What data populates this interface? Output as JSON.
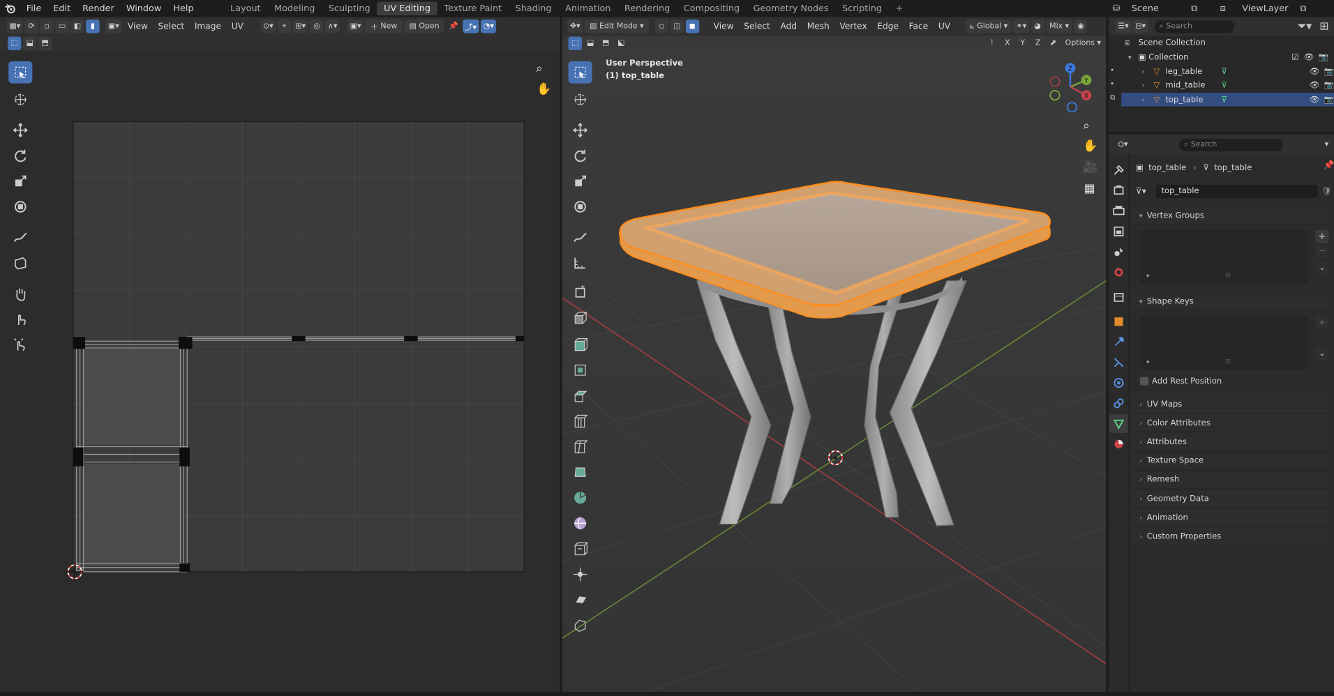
{
  "topbar": {
    "menus": [
      "File",
      "Edit",
      "Render",
      "Window",
      "Help"
    ],
    "workspaces": [
      {
        "label": "Layout",
        "active": false
      },
      {
        "label": "Modeling",
        "active": false
      },
      {
        "label": "Sculpting",
        "active": false
      },
      {
        "label": "UV Editing",
        "active": true
      },
      {
        "label": "Texture Paint",
        "active": false
      },
      {
        "label": "Shading",
        "active": false
      },
      {
        "label": "Animation",
        "active": false
      },
      {
        "label": "Rendering",
        "active": false
      },
      {
        "label": "Compositing",
        "active": false
      },
      {
        "label": "Geometry Nodes",
        "active": false
      },
      {
        "label": "Scripting",
        "active": false
      }
    ],
    "add_tab": "+",
    "scene": "Scene",
    "view_layer": "ViewLayer"
  },
  "uv_editor": {
    "menus": [
      "View",
      "Select",
      "Image",
      "UV"
    ],
    "new_label": "New",
    "open_label": "Open"
  },
  "viewport": {
    "mode": "Edit Mode",
    "menus": [
      "View",
      "Select",
      "Add",
      "Mesh",
      "Vertex",
      "Edge",
      "Face",
      "UV"
    ],
    "orientation": "Global",
    "shading_mix": "Mix",
    "options_label": "Options",
    "axis_x": "X",
    "axis_y": "Y",
    "axis_z": "Z",
    "overlay_line1": "User Perspective",
    "overlay_line2": "(1) top_table",
    "gizmo": {
      "x": "X",
      "y": "Y",
      "z": "Z"
    }
  },
  "outliner": {
    "search_placeholder": "Search",
    "scene_collection": "Scene Collection",
    "collection": "Collection",
    "objects": [
      "leg_table",
      "mid_table",
      "top_table"
    ]
  },
  "properties": {
    "search_placeholder": "Search",
    "breadcrumb_object": "top_table",
    "breadcrumb_data": "top_table",
    "mesh_name": "top_table",
    "vertex_groups": "Vertex Groups",
    "shape_keys": "Shape Keys",
    "add_rest_position": "Add Rest Position",
    "sections": [
      "UV Maps",
      "Color Attributes",
      "Attributes",
      "Texture Space",
      "Remesh",
      "Geometry Data",
      "Animation",
      "Custom Properties"
    ]
  },
  "colors": {
    "accent_blue": "#4772b3",
    "selection_orange": "#ff8c1a",
    "x_axis": "#c4444c",
    "y_axis": "#7aa53b",
    "z_axis": "#3c7be0"
  }
}
